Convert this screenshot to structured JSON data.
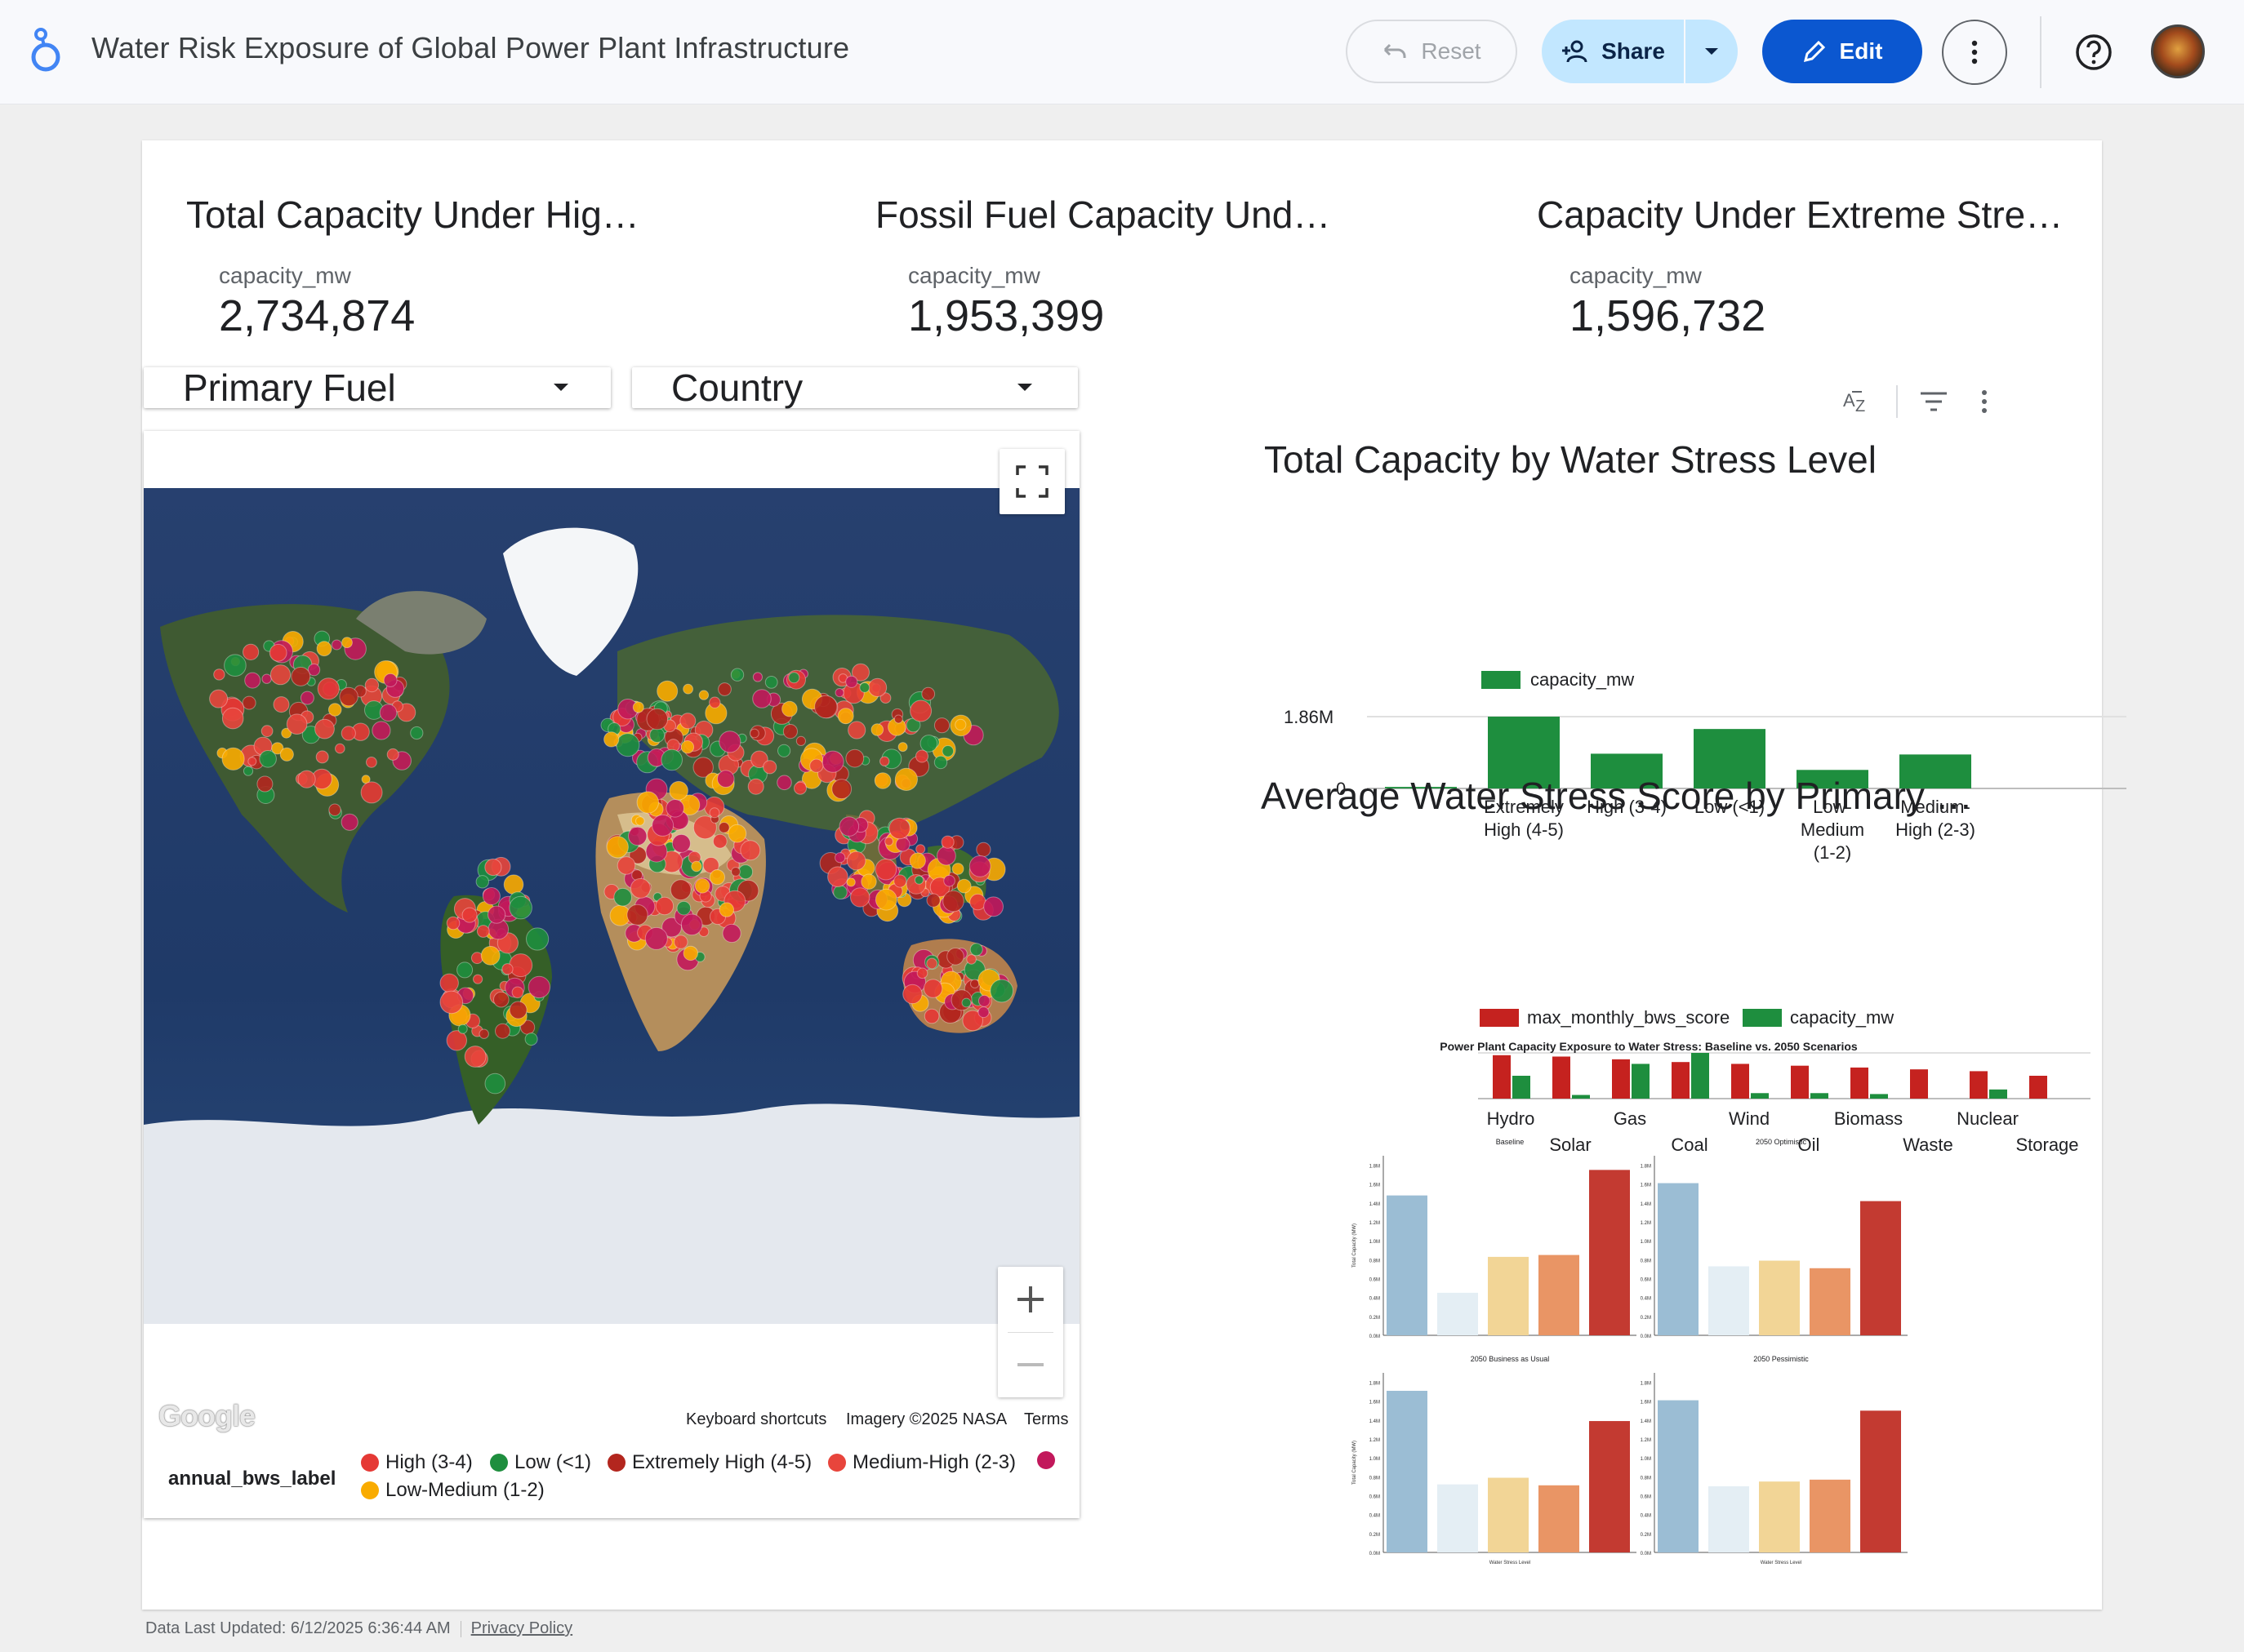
{
  "app": {
    "title": "Water Risk Exposure of Global Power Plant Infrastructure",
    "reset_label": "Reset",
    "share_label": "Share",
    "edit_label": "Edit"
  },
  "kpis": [
    {
      "title": "Total Capacity Under Hig…",
      "metric": "capacity_mw",
      "value": "2,734,874"
    },
    {
      "title": "Fossil Fuel Capacity Und…",
      "metric": "capacity_mw",
      "value": "1,953,399"
    },
    {
      "title": "Capacity Under Extreme Stre…",
      "metric": "capacity_mw",
      "value": "1,596,732"
    }
  ],
  "filters": {
    "primary_fuel": "Primary Fuel",
    "country": "Country"
  },
  "map": {
    "footer_shortcuts": "Keyboard shortcuts",
    "footer_imagery": "Imagery ©2025 NASA",
    "footer_terms": "Terms",
    "google": "Google",
    "legend_title": "annual_bws_label",
    "legend": [
      {
        "label": "High (3-4)",
        "color": "#e53935"
      },
      {
        "label": "Low (<1)",
        "color": "#1e8e3e"
      },
      {
        "label": "Extremely High (4-5)",
        "color": "#b3261e"
      },
      {
        "label": "Medium-High (2-3)",
        "color": "#e8453c"
      },
      {
        "label": "",
        "color": "#c2185b"
      },
      {
        "label": "Low-Medium (1-2)",
        "color": "#f9ab00"
      }
    ]
  },
  "chart_titles": {
    "stress_level": "Total Capacity by Water Stress Level",
    "fuel": "Average Water Stress Score by Primary …",
    "scenario": "Power Plant Capacity Exposure to Water Stress: Baseline vs. 2050 Scenarios"
  },
  "footer": {
    "updated": "Data Last Updated: 6/12/2025 6:36:44 AM",
    "privacy": "Privacy Policy"
  },
  "colors": {
    "green": "#1e8e3e",
    "red": "#c5221f",
    "accent": "#0b57d0"
  },
  "chart_data": [
    {
      "type": "bar",
      "title": "Total Capacity by Water Stress Level",
      "categories": [
        "",
        "Extremely High (4-5)",
        "High (3-4)",
        "Low (<1)",
        "Low-Medium (1-2)",
        "Medium-High (2-3)"
      ],
      "series": [
        {
          "name": "capacity_mw",
          "values": [
            40000,
            1860000,
            900000,
            1540000,
            480000,
            880000
          ]
        }
      ],
      "ylim": [
        0,
        1860000
      ],
      "ytick_labels": [
        "0",
        "1.86M"
      ],
      "legend": "top-left"
    },
    {
      "type": "bar",
      "title": "Average Water Stress Score by Primary …",
      "categories": [
        "Hydro",
        "Solar",
        "Gas",
        "Coal",
        "Wind",
        "Oil",
        "Biomass",
        "Waste",
        "Nuclear",
        "Storage"
      ],
      "series": [
        {
          "name": "max_monthly_bws_score",
          "values": [
            0.95,
            0.92,
            0.86,
            0.8,
            0.76,
            0.72,
            0.68,
            0.64,
            0.6,
            0.5
          ]
        },
        {
          "name": "capacity_mw",
          "values": [
            0.5,
            0.08,
            0.76,
            1.0,
            0.12,
            0.12,
            0.1,
            0.0,
            0.2,
            0.0
          ]
        }
      ],
      "legend": "top-left"
    },
    {
      "type": "bar",
      "title": "Power Plant Capacity Exposure to Water Stress: Baseline vs. 2050 Scenarios",
      "ylabel": "Total Capacity (MW)",
      "xlabel": "Water Stress Level",
      "ytick_labels": [
        "0.0M",
        "0.2M",
        "0.4M",
        "0.6M",
        "0.8M",
        "1.0M",
        "1.2M",
        "1.4M",
        "1.6M",
        "1.8M"
      ],
      "ylim": [
        0,
        1.9
      ],
      "colors": [
        "#9bbdd4",
        "#e4eef4",
        "#f2d596",
        "#e99565",
        "#c33a31"
      ],
      "panels": [
        {
          "name": "Baseline",
          "values": [
            1.48,
            0.45,
            0.83,
            0.85,
            1.75
          ]
        },
        {
          "name": "2050 Optimistic",
          "values": [
            1.61,
            0.73,
            0.79,
            0.71,
            1.42
          ]
        },
        {
          "name": "2050 Business as Usual",
          "values": [
            1.71,
            0.72,
            0.79,
            0.71,
            1.39
          ]
        },
        {
          "name": "2050 Pessimistic",
          "values": [
            1.61,
            0.7,
            0.75,
            0.77,
            1.5
          ]
        }
      ]
    }
  ]
}
